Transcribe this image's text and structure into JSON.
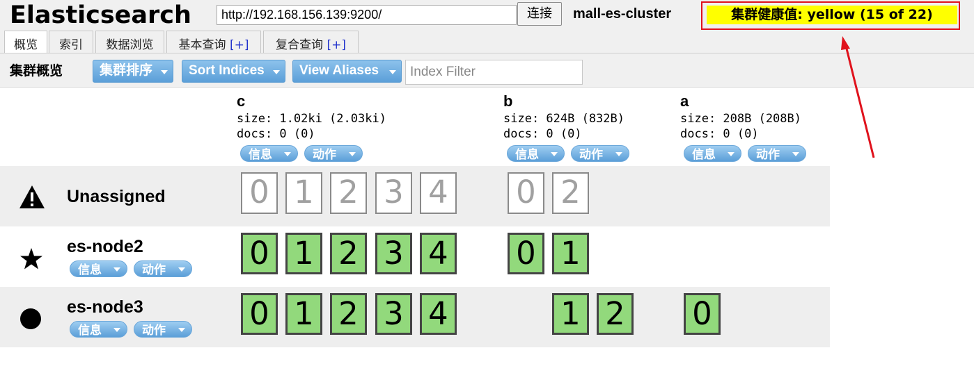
{
  "header": {
    "app_title": "Elasticsearch",
    "url_value": "http://192.168.156.139:9200/",
    "connect_label": "连接",
    "cluster_name": "mall-es-cluster",
    "health": "集群健康值: yellow (15 of 22)",
    "health_color": "#ffff00"
  },
  "tabs": [
    {
      "label": "概览",
      "active": true
    },
    {
      "label": "索引"
    },
    {
      "label": "数据浏览"
    },
    {
      "label": "基本查询",
      "suffix": "[+]"
    },
    {
      "label": "复合查询",
      "suffix": "[+]"
    }
  ],
  "toolbar": {
    "title": "集群概览",
    "sort_cluster_label": "集群排序",
    "sort_indices_label": "Sort Indices",
    "view_aliases_label": "View Aliases",
    "index_filter_placeholder": "Index Filter"
  },
  "indices": [
    {
      "name": "c",
      "size": "size: 1.02ki (2.03ki)",
      "docs": "docs: 0 (0)",
      "info_label": "信息",
      "action_label": "动作"
    },
    {
      "name": "b",
      "size": "size: 624B (832B)",
      "docs": "docs: 0 (0)",
      "info_label": "信息",
      "action_label": "动作"
    },
    {
      "name": "a",
      "size": "size: 208B (208B)",
      "docs": "docs: 0 (0)",
      "info_label": "信息",
      "action_label": "动作"
    }
  ],
  "nodes": [
    {
      "name": "Unassigned",
      "icon": "warning-icon",
      "shards": {
        "c": [
          "0",
          "1",
          "2",
          "3",
          "4"
        ],
        "b": [
          "0",
          "2"
        ],
        "a": []
      }
    },
    {
      "name": "es-node2",
      "icon": "star-icon",
      "info_label": "信息",
      "action_label": "动作",
      "shards": {
        "c": [
          "0",
          "1",
          "2",
          "3",
          "4"
        ],
        "b": [
          "0",
          "1"
        ],
        "a": []
      }
    },
    {
      "name": "es-node3",
      "icon": "circle-icon",
      "info_label": "信息",
      "action_label": "动作",
      "shards": {
        "c": [
          "0",
          "1",
          "2",
          "3",
          "4"
        ],
        "b": [
          "1",
          "2"
        ],
        "a": [
          "0"
        ]
      }
    }
  ],
  "colors": {
    "shard_started": "#92d97c",
    "shard_border": "#444444",
    "button_blue": "#5b9fd8",
    "annotation_red": "#e0121c"
  }
}
